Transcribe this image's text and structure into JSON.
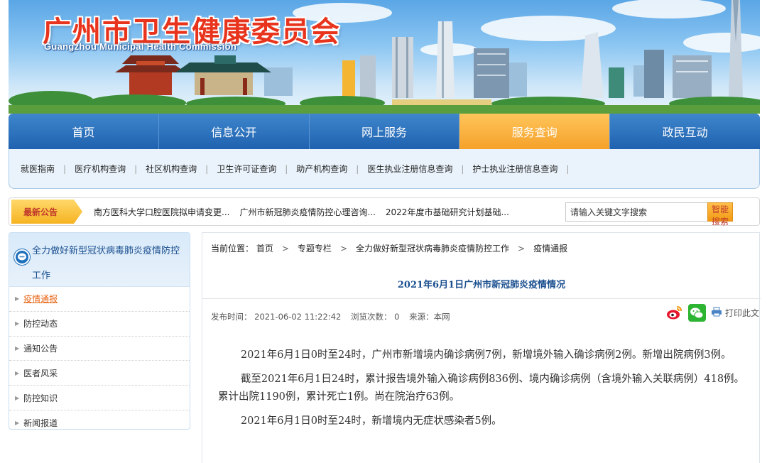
{
  "site": {
    "title": "广州市卫生健康委员会",
    "subtitle": "Guangzhou Municipal Health Commission"
  },
  "main_nav": [
    {
      "label": "首页",
      "active": false
    },
    {
      "label": "信息公开",
      "active": false
    },
    {
      "label": "网上服务",
      "active": false
    },
    {
      "label": "服务查询",
      "active": true
    },
    {
      "label": "政民互动",
      "active": false
    }
  ],
  "sub_nav": [
    "就医指南",
    "医疗机构查询",
    "社区机构查询",
    "卫生许可证查询",
    "助产机构查询",
    "医生执业注册信息查询",
    "护士执业注册信息查询"
  ],
  "notice": {
    "label": "最新公告",
    "items": [
      "南方医科大学口腔医院拟申请变更...",
      "广州市新冠肺炎疫情防控心理咨询...",
      "2022年度市基础研究计划基础..."
    ]
  },
  "search": {
    "placeholder": "请输入关键文字搜索",
    "button_label": "智能搜索"
  },
  "sidebar": {
    "title": "全力做好新型冠状病毒肺炎疫情防控工作",
    "items": [
      {
        "label": "疫情通报",
        "active": true
      },
      {
        "label": "防控动态",
        "active": false
      },
      {
        "label": "通知公告",
        "active": false
      },
      {
        "label": "医者风采",
        "active": false
      },
      {
        "label": "防控知识",
        "active": false
      },
      {
        "label": "新闻报道",
        "active": false
      }
    ]
  },
  "breadcrumb": {
    "prefix": "当前位置：",
    "items": [
      "首页",
      "专题专栏",
      "全力做好新型冠状病毒肺炎疫情防控工作",
      "疫情通报"
    ],
    "separator": ">"
  },
  "article": {
    "title": "2021年6月1日广州市新冠肺炎疫情情况",
    "publish_label": "发布时间：",
    "publish_time": "2021-06-02 11:22:42",
    "views_label": "浏览次数：",
    "views": "0",
    "source_label": "来源：",
    "source": "本网",
    "print_label": "打印此文",
    "paragraphs": [
      "2021年6月1日0时至24时，广州市新增境内确诊病例7例，新增境外输入确诊病例2例。新增出院病例3例。",
      "截至2021年6月1日24时，累计报告境外输入确诊病例836例、境内确诊病例（含境外输入关联病例）418例。累计出院1190例，累计死亡1例。尚在院治疗63例。",
      "2021年6月1日0时至24时，新增境内无症状感染者5例。"
    ]
  },
  "icons": {
    "sidebar_header": "chat-bubble-icon",
    "share": [
      "weibo-icon",
      "wechat-icon",
      "printer-icon"
    ],
    "list_bullet": "triangle-right-icon"
  },
  "colors": {
    "nav_blue": "#2a6fbe",
    "nav_active_orange": "#f5a12a",
    "title_red": "#e8341c",
    "link_blue": "#1a4f8f",
    "active_orange": "#e8691c"
  }
}
